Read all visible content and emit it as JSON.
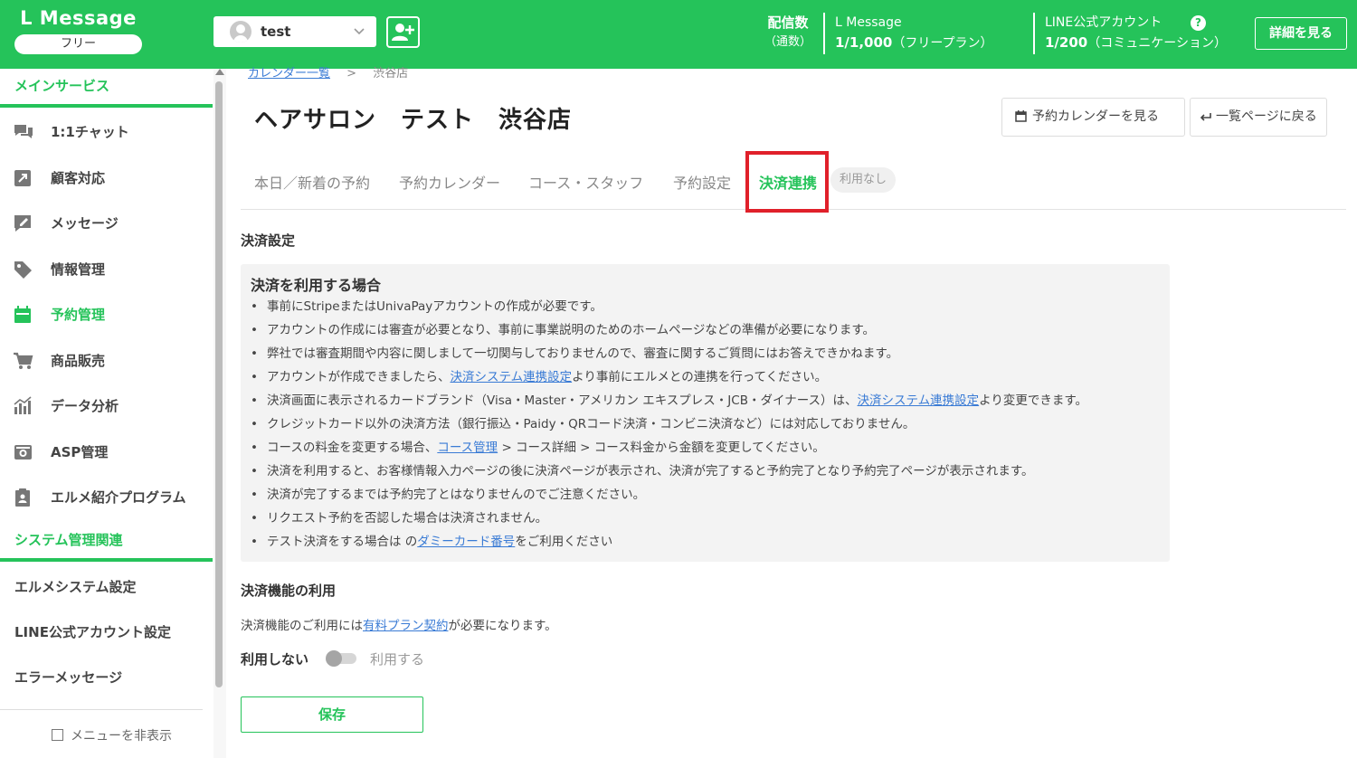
{
  "header": {
    "logo": "L Message",
    "plan": "フリー",
    "account_name": "test",
    "delivery_label": "配信数",
    "delivery_sub": "（通数）",
    "lmessage_label": "L Message",
    "lmessage_count": "1/1,000",
    "lmessage_plan": "（フリープラン）",
    "line_label": "LINE公式アカウント",
    "line_count": "1/200",
    "line_plan": "（コミュニケーション）",
    "help": "?",
    "detail_button": "詳細を見る"
  },
  "sidebar": {
    "main_section": "メインサービス",
    "items": [
      {
        "label": "1:1チャット"
      },
      {
        "label": "顧客対応"
      },
      {
        "label": "メッセージ"
      },
      {
        "label": "情報管理"
      },
      {
        "label": "予約管理"
      },
      {
        "label": "商品販売"
      },
      {
        "label": "データ分析"
      },
      {
        "label": "ASP管理"
      },
      {
        "label": "エルメ紹介プログラム"
      }
    ],
    "system_section": "システム管理関連",
    "system_items": [
      {
        "label": "エルメシステム設定"
      },
      {
        "label": "LINE公式アカウント設定"
      },
      {
        "label": "エラーメッセージ"
      }
    ],
    "hide_menu": "メニューを非表示",
    "accent_color": "#25c35a"
  },
  "breadcrumb": {
    "parent": "カレンダー一覧",
    "separator": ">",
    "current": "渋谷店"
  },
  "page": {
    "title": "ヘアサロン　テスト　渋谷店",
    "view_calendar_button": "予約カレンダーを見る",
    "back_button": "一覧ページに戻る"
  },
  "tabs": [
    {
      "label": "本日／新着の予約"
    },
    {
      "label": "予約カレンダー"
    },
    {
      "label": "コース・スタッフ"
    },
    {
      "label": "予約設定"
    },
    {
      "label": "決済連携"
    }
  ],
  "tab_badge": "利用なし",
  "payment": {
    "section_title": "決済設定",
    "notice_title": "決済を利用する場合",
    "notes": [
      {
        "text": "事前にStripeまたはUnivaPayアカウントの作成が必要です。"
      },
      {
        "text": "アカウントの作成には審査が必要となり、事前に事業説明のためのホームページなどの準備が必要になります。"
      },
      {
        "text": "弊社では審査期間や内容に関しまして一切関与しておりませんので、審査に関するご質問にはお答えできかねます。"
      },
      {
        "pre": "アカウントが作成できましたら、",
        "link": "決済システム連携設定",
        "post": "より事前にエルメとの連携を行ってください。"
      },
      {
        "pre": "決済画面に表示されるカードブランド（Visa・Master・アメリカン エキスプレス・JCB・ダイナース）は、",
        "link": "決済システム連携設定",
        "post": "より変更できます。"
      },
      {
        "text": "クレジットカード以外の決済方法（銀行振込・Paidy・QRコード決済・コンビニ決済など）には対応しておりません。"
      },
      {
        "pre": "コースの料金を変更する場合、",
        "link": "コース管理",
        "post": " > コース詳細 > コース料金から金額を変更してください。"
      },
      {
        "text": "決済を利用すると、お客様情報入力ページの後に決済ページが表示され、決済が完了すると予約完了となり予約完了ページが表示されます。"
      },
      {
        "text": "決済が完了するまでは予約完了とはなりませんのでご注意ください。"
      },
      {
        "text": "リクエスト予約を否認した場合は決済されません。"
      },
      {
        "pre": "テスト決済をする場合は の",
        "link": "ダミーカード番号",
        "post": "をご利用ください"
      }
    ],
    "usage_title": "決済機能の利用",
    "usage_pre": "決済機能のご利用には",
    "usage_link": "有料プラン契約",
    "usage_post": "が必要になります。",
    "toggle_off_label": "利用しない",
    "toggle_on_label": "利用する",
    "save_button": "保存"
  }
}
